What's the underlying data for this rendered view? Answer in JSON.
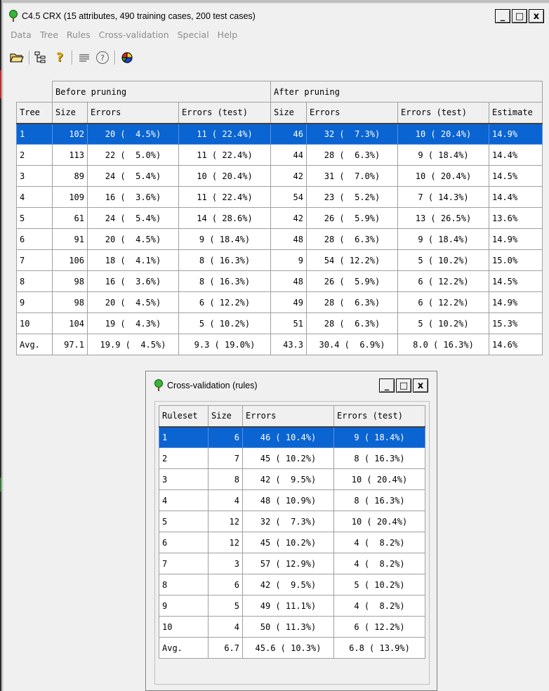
{
  "window": {
    "title": "C4.5  CRX (15 attributes, 490 training cases, 200 test cases)",
    "minimize_label": "_",
    "maximize_label": "□",
    "close_label": "x"
  },
  "menu": [
    "Data",
    "Tree",
    "Rules",
    "Cross-validation",
    "Special",
    "Help"
  ],
  "toolbar": {
    "icons": [
      "open-folder-icon",
      "tree-icon",
      "question-icon",
      "list-icon",
      "help-circle-icon",
      "pie-chart-icon"
    ],
    "question_glyph": "?",
    "help_glyph": "?"
  },
  "tree_table": {
    "group_headers": [
      "Before pruning",
      "After pruning"
    ],
    "columns": [
      "Tree",
      "Size",
      "Errors",
      "Errors (test)",
      "Size",
      "Errors",
      "Errors (test)",
      "Estimate"
    ],
    "selected_row": 0,
    "rows": [
      [
        "1",
        "102",
        "20 (  4.5%)",
        "11 ( 22.4%)",
        "46",
        "32 (  7.3%)",
        "10 ( 20.4%)",
        "14.9%"
      ],
      [
        "2",
        "113",
        "22 (  5.0%)",
        "11 ( 22.4%)",
        "44",
        "28 (  6.3%)",
        "9 ( 18.4%)",
        "14.4%"
      ],
      [
        "3",
        "89",
        "24 (  5.4%)",
        "10 ( 20.4%)",
        "42",
        "31 (  7.0%)",
        "10 ( 20.4%)",
        "14.5%"
      ],
      [
        "4",
        "109",
        "16 (  3.6%)",
        "11 ( 22.4%)",
        "54",
        "23 (  5.2%)",
        "7 ( 14.3%)",
        "14.4%"
      ],
      [
        "5",
        "61",
        "24 (  5.4%)",
        "14 ( 28.6%)",
        "42",
        "26 (  5.9%)",
        "13 ( 26.5%)",
        "13.6%"
      ],
      [
        "6",
        "91",
        "20 (  4.5%)",
        "9 ( 18.4%)",
        "48",
        "28 (  6.3%)",
        "9 ( 18.4%)",
        "14.9%"
      ],
      [
        "7",
        "106",
        "18 (  4.1%)",
        "8 ( 16.3%)",
        "9",
        "54 ( 12.2%)",
        "5 ( 10.2%)",
        "15.0%"
      ],
      [
        "8",
        "98",
        "16 (  3.6%)",
        "8 ( 16.3%)",
        "48",
        "26 (  5.9%)",
        "6 ( 12.2%)",
        "14.5%"
      ],
      [
        "9",
        "98",
        "20 (  4.5%)",
        "6 ( 12.2%)",
        "49",
        "28 (  6.3%)",
        "6 ( 12.2%)",
        "14.9%"
      ],
      [
        "10",
        "104",
        "19 (  4.3%)",
        "5 ( 10.2%)",
        "51",
        "28 (  6.3%)",
        "5 ( 10.2%)",
        "15.3%"
      ],
      [
        "Avg.",
        "97.1",
        "19.9 (  4.5%)",
        "9.3 ( 19.0%)",
        "43.3",
        "30.4 (  6.9%)",
        "8.0 ( 16.3%)",
        "14.6%"
      ]
    ]
  },
  "rules_window": {
    "title": "Cross-validation (rules)",
    "minimize_label": "_",
    "maximize_label": "□",
    "close_label": "x",
    "columns": [
      "Ruleset",
      "Size",
      "Errors",
      "Errors (test)"
    ],
    "selected_row": 0,
    "rows": [
      [
        "1",
        "6",
        "46 ( 10.4%)",
        "9 ( 18.4%)"
      ],
      [
        "2",
        "7",
        "45 ( 10.2%)",
        "8 ( 16.3%)"
      ],
      [
        "3",
        "8",
        "42 (  9.5%)",
        "10 ( 20.4%)"
      ],
      [
        "4",
        "4",
        "48 ( 10.9%)",
        "8 ( 16.3%)"
      ],
      [
        "5",
        "12",
        "32 (  7.3%)",
        "10 ( 20.4%)"
      ],
      [
        "6",
        "12",
        "45 ( 10.2%)",
        "4 (  8.2%)"
      ],
      [
        "7",
        "3",
        "57 ( 12.9%)",
        "4 (  8.2%)"
      ],
      [
        "8",
        "6",
        "42 (  9.5%)",
        "5 ( 10.2%)"
      ],
      [
        "9",
        "5",
        "49 ( 11.1%)",
        "4 (  8.2%)"
      ],
      [
        "10",
        "4",
        "50 ( 11.3%)",
        "6 ( 12.2%)"
      ],
      [
        "Avg.",
        "6.7",
        "45.6 ( 10.3%)",
        "6.8 ( 13.9%)"
      ]
    ]
  },
  "colors": {
    "selection": "#0a64d2",
    "window_bg": "#f0f0f0",
    "menu_text": "#8c8c8c"
  }
}
